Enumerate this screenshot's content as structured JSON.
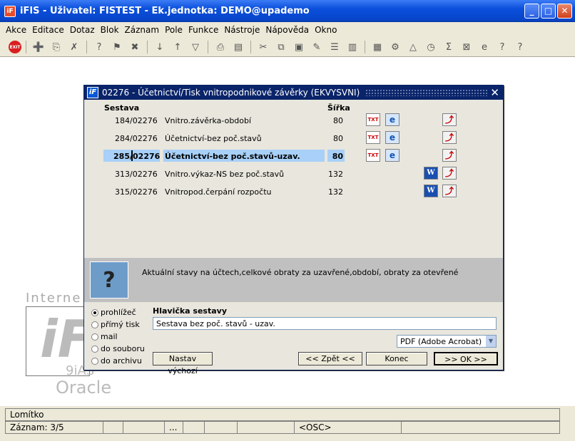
{
  "window": {
    "title": "iFIS - Uživatel: FISTEST - Ek.jednotka: DEMO@upademo"
  },
  "menu": [
    "Akce",
    "Editace",
    "Dotaz",
    "Blok",
    "Záznam",
    "Pole",
    "Funkce",
    "Nástroje",
    "Nápověda",
    "Okno"
  ],
  "toolbar": {
    "exit_label": "EXIT"
  },
  "watermark": {
    "line1": "Interne",
    "line2": "9iAS",
    "line3": "Oracle",
    "logo": "iF"
  },
  "dialog": {
    "title": "02276 - Účetnictví/Tisk vnitropodnikové závěrky (EKVYSVNI)",
    "col_sestava": "Sestava",
    "col_sirka": "Šířka",
    "rows": [
      {
        "num": "184",
        "slash": "/02276",
        "name": "Vnitro.závěrka-období",
        "width": "80",
        "icons": [
          "txt",
          "ie",
          "pdf"
        ]
      },
      {
        "num": "284",
        "slash": "/02276",
        "name": "Účetnictví-bez poč.stavů",
        "width": "80",
        "icons": [
          "txt",
          "ie",
          "pdf"
        ]
      },
      {
        "num": "285",
        "slash": "/02276",
        "name": "Účetnictví-bez poč.stavů-uzav.",
        "width": "80",
        "icons": [
          "txt",
          "ie",
          "pdf"
        ],
        "selected": true
      },
      {
        "num": "313",
        "slash": "/02276",
        "name": "Vnitro.výkaz-NS bez poč.stavů",
        "width": "132",
        "icons": [
          "word",
          "pdf"
        ]
      },
      {
        "num": "315",
        "slash": "/02276",
        "name": "Vnitropod.čerpání rozpočtu",
        "width": "132",
        "icons": [
          "word",
          "pdf"
        ]
      }
    ],
    "description": "Aktuální stavy na účtech,celkové obraty za uzavřené,období, obraty za otevřené",
    "output_options": [
      "prohlížeč",
      "přímý tisk",
      "mail",
      "do souboru",
      "do archivu"
    ],
    "output_selected": 0,
    "header_label": "Hlavička sestavy",
    "header_value": "Sestava bez poč. stavů - uzav.",
    "format_selected": "PDF (Adobe Acrobat)",
    "btn_default": "Nastav výchozí",
    "btn_back": "<< Zpět <<",
    "btn_end": "Konec",
    "btn_ok": ">> OK >>"
  },
  "status": {
    "line1": "Lomítko",
    "record": "Záznam: 3/5",
    "ellipsis": "...",
    "osc": "<OSC>"
  }
}
